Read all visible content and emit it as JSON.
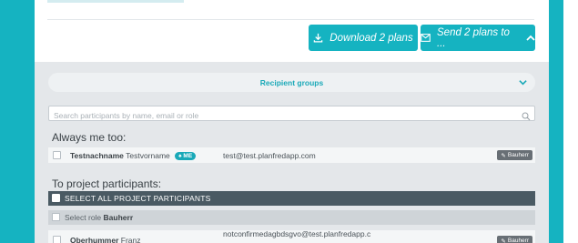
{
  "actions": {
    "download_label": "Download 2 plans",
    "send_label": "Send 2 plans to ..."
  },
  "recipient_groups": {
    "label": "Recipient groups"
  },
  "search": {
    "placeholder": "Search participants by name, email or role"
  },
  "always_me": {
    "title": "Always me too:",
    "person": {
      "last_name": "Testnachname",
      "first_name": "Testvorname",
      "badge": "ME",
      "email": "test@test.planfredapp.com",
      "role": "Bauherr"
    }
  },
  "project_participants": {
    "title": "To project participants:",
    "select_all_label": "SELECT ALL PROJECT PARTICIPANTS",
    "select_role_prefix": "Select role",
    "select_role_name": "Bauherr",
    "people": [
      {
        "last_name": "Oberhummer",
        "first_name": "Franz",
        "email": "notconfirmedagbdsgvo@test.planfredapp.c",
        "role": "Bauherr"
      }
    ]
  },
  "colors": {
    "accent": "#15b3c1",
    "dark_bar": "#4a5a63",
    "panel": "#e4e7ea"
  },
  "icons": [
    "download-icon",
    "envelope-icon",
    "chevron-up-icon",
    "chevron-down-icon",
    "search-icon",
    "user-icon",
    "role-icon"
  ]
}
